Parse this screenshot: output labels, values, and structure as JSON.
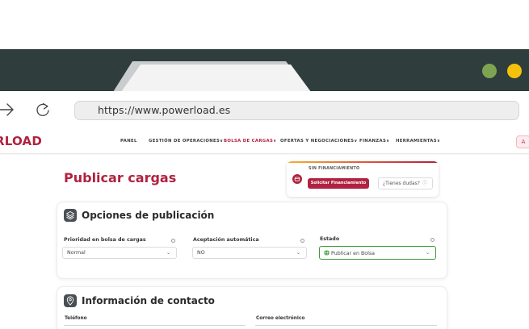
{
  "browser": {
    "url": "https://www.powerload.es"
  },
  "app": {
    "logo": "RLOAD",
    "user_initial": "A",
    "nav": [
      {
        "label": "PANEL",
        "chevron": ""
      },
      {
        "label": "GESTIÓN DE OPERACIONES",
        "chevron": "∨"
      },
      {
        "label": "BOLSA DE CARGAS",
        "chevron": "∨"
      },
      {
        "label": "OFERTAS Y NEGOCIACIONES",
        "chevron": "∨"
      },
      {
        "label": "FINANZAS",
        "chevron": "∨"
      },
      {
        "label": "HERRAMIENTAS",
        "chevron": "∨"
      }
    ]
  },
  "page": {
    "title": "Publicar cargas"
  },
  "financing": {
    "label": "SIN FINANCIAMIENTO",
    "button": "Solicitar Financiamiento",
    "help": "¿Tienes dudas?"
  },
  "publication": {
    "title": "Opciones de publicación",
    "fields": [
      {
        "label": "Prioridad en bolsa de cargas",
        "value": "Normal"
      },
      {
        "label": "Aceptación automática",
        "value": "NO"
      },
      {
        "label": "Estado",
        "value": "Publicar en Bolsa"
      }
    ]
  },
  "contact": {
    "title": "Información de contacto",
    "phone_label": "Teléfono",
    "email_label": "Correo electrónico"
  },
  "colors": {
    "brand": "#b0223f",
    "titlebar": "#2f3d3d",
    "status_green": "#3f9a3a"
  }
}
